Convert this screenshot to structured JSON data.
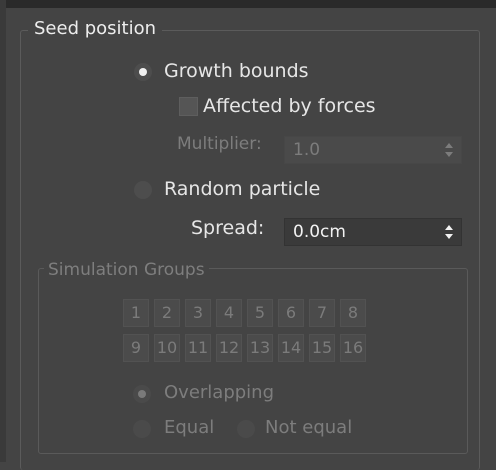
{
  "seed_position": {
    "title": "Seed position",
    "growth_bounds_label": "Growth bounds",
    "growth_bounds_selected": true,
    "affected_by_forces_label": "Affected by forces",
    "affected_by_forces_checked": false,
    "multiplier_label": "Multiplier:",
    "multiplier_value": "1.0",
    "random_particle_label": "Random particle",
    "random_particle_selected": false,
    "spread_label": "Spread:",
    "spread_value": "0.0cm"
  },
  "simulation_groups": {
    "title": "Simulation Groups",
    "groups": [
      "1",
      "2",
      "3",
      "4",
      "5",
      "6",
      "7",
      "8",
      "9",
      "10",
      "11",
      "12",
      "13",
      "14",
      "15",
      "16"
    ],
    "overlapping_label": "Overlapping",
    "overlapping_selected": true,
    "equal_label": "Equal",
    "equal_selected": false,
    "not_equal_label": "Not equal",
    "not_equal_selected": false
  }
}
